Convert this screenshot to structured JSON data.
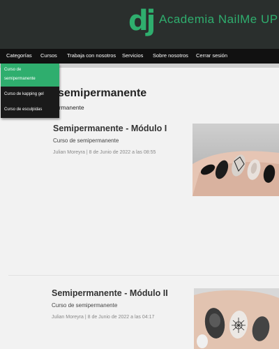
{
  "header": {
    "logo_text": "dj",
    "site_title": "Academia NailMe UP"
  },
  "nav": {
    "items": [
      {
        "label": "Categorías"
      },
      {
        "label": "Cursos"
      },
      {
        "label": "Trabaja con nosotros"
      },
      {
        "label": "Servicios"
      },
      {
        "label": "Sobre nosotros"
      },
      {
        "label": "Cerrar sesión"
      }
    ]
  },
  "dropdown": {
    "items": [
      {
        "label_line1": "Curso de",
        "label_line2": "semipermanente",
        "active": true
      },
      {
        "label_line1": "Curso de kapping gel"
      },
      {
        "label_line1": "Curso de esculpidas"
      }
    ]
  },
  "page": {
    "heading": "semipermanente",
    "subheading": "ermanente"
  },
  "posts": [
    {
      "title": "Semipermanente - Módulo I",
      "category": "Curso de semipermanente",
      "meta": "Julian Moreyra | 8 de Junio de 2022 a las 08:55"
    },
    {
      "title": "Semipermanente - Módulo II",
      "category": "Curso de semipermanente",
      "meta": "Julian Moreyra | 8 de Junio de 2022 a las 04:17"
    }
  ],
  "colors": {
    "accent": "#2fae6e",
    "header_bg": "#2a2f2d",
    "nav_bg": "#111111"
  }
}
